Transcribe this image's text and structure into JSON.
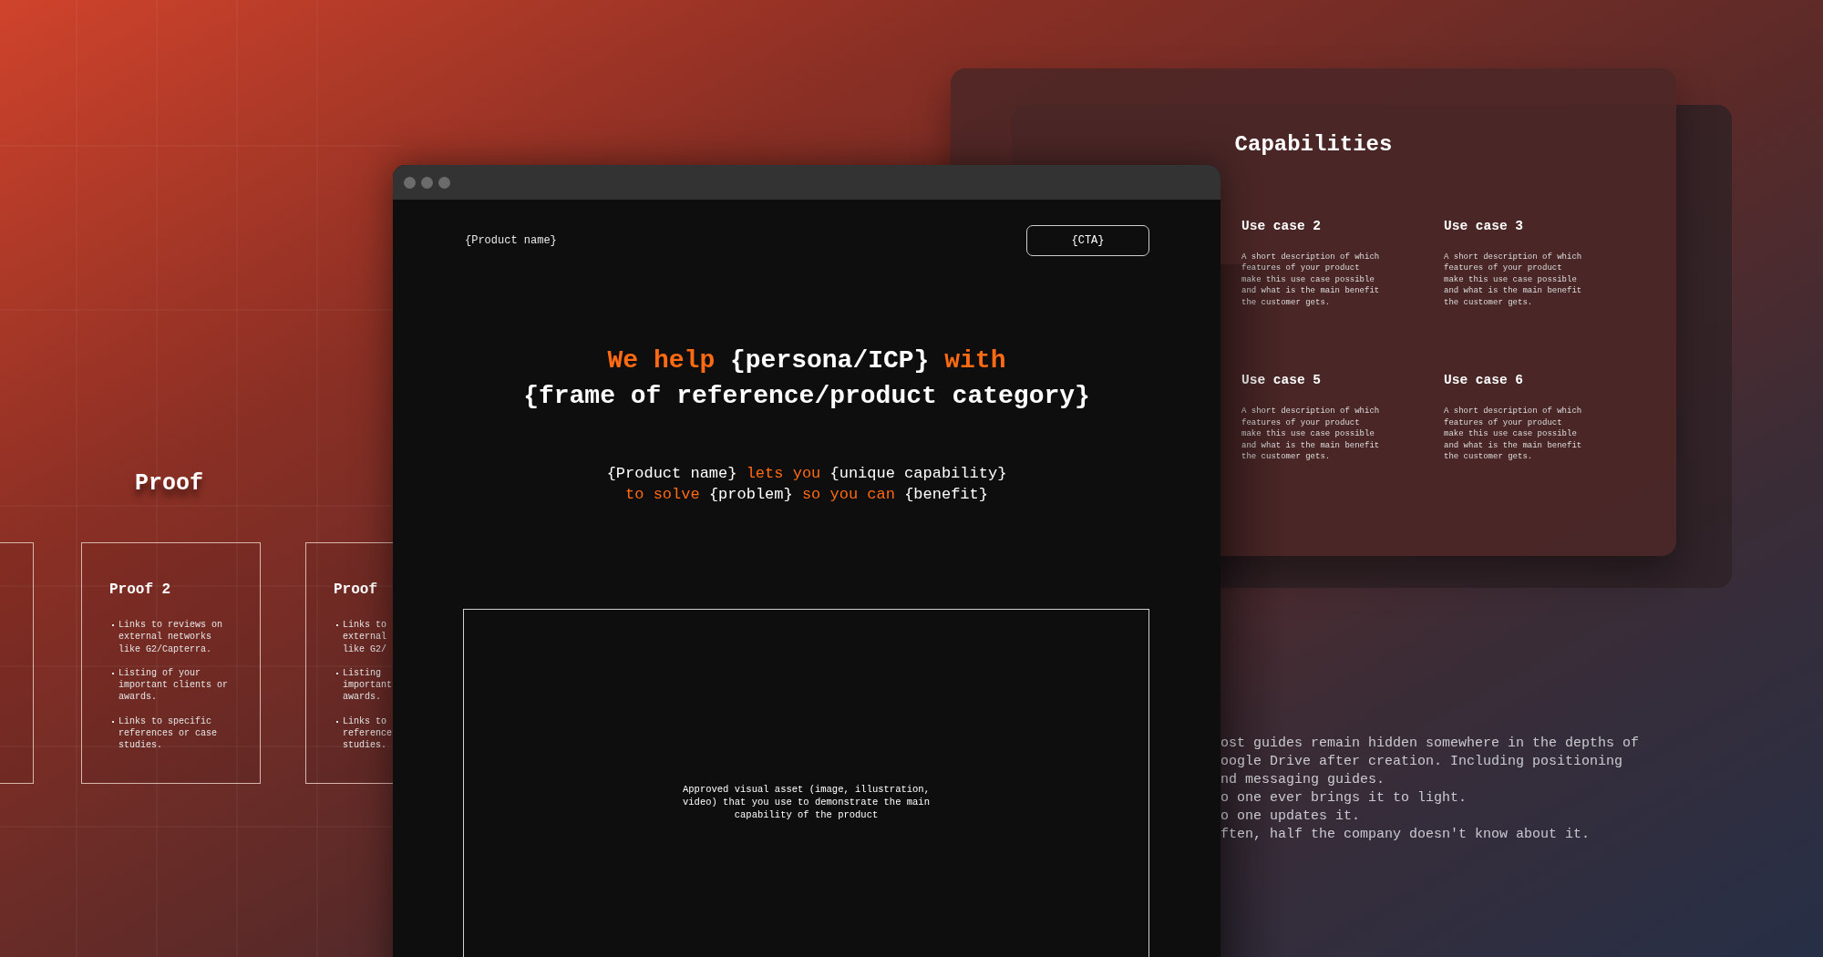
{
  "proof_section": {
    "title": "Proof",
    "cards": [
      {
        "kind": "blank"
      },
      {
        "kind": "text",
        "title": "Proof 2",
        "bullets": [
          [
            "Links to reviews on",
            "external networks",
            "like G2/Capterra."
          ],
          [
            "Listing of your",
            "important clients or",
            "awards."
          ],
          [
            "Links to specific",
            "references or case",
            "studies."
          ]
        ]
      },
      {
        "kind": "text",
        "title": "Proof",
        "bullets": [
          [
            "Links to",
            "external",
            "like G2/"
          ],
          [
            "Listing",
            "important",
            "awards."
          ],
          [
            "Links to",
            "reference",
            "studies."
          ]
        ]
      }
    ]
  },
  "capabilities": {
    "title": "Capabilities",
    "use_cases": [
      {
        "title": "Use case 2",
        "description": "A short description of which features of your product make this use case possible and what is the main benefit the customer gets."
      },
      {
        "title": "Use case 3",
        "description": "A short description of which features of your product make this use case possible and what is the main benefit the customer gets."
      },
      {
        "title": "Use case 5",
        "description": "A short description of which features of your product make this use case possible and what is the main benefit the customer gets."
      },
      {
        "title": "Use case 6",
        "description": "A short description of which features of your product make this use case possible and what is the main benefit the customer gets."
      }
    ]
  },
  "browser": {
    "product_name": "{Product name}",
    "cta": "{CTA}",
    "headline": [
      [
        {
          "text": "We help ",
          "accent": true
        },
        {
          "text": "{persona/ICP}",
          "accent": false
        },
        {
          "text": " with",
          "accent": true
        }
      ],
      [
        {
          "text": "{frame of reference/product category}",
          "accent": false
        }
      ]
    ],
    "subline": [
      [
        {
          "text": "{Product name}",
          "accent": false
        },
        {
          "text": " lets you ",
          "accent": true
        },
        {
          "text": "{unique capability}",
          "accent": false
        }
      ],
      [
        {
          "text": "to solve ",
          "accent": true
        },
        {
          "text": "{problem}",
          "accent": false
        },
        {
          "text": " so you can ",
          "accent": true
        },
        {
          "text": "{benefit}",
          "accent": false
        }
      ]
    ],
    "asset_text": "Approved visual asset (image, illustration, video) that you use to demonstrate the main capability of the product"
  },
  "note_lines": [
    "ost guides remain hidden somewhere in the depths of",
    "oogle Drive after creation. Including positioning",
    "nd messaging guides.",
    "o one ever brings it to light.",
    "o one updates it.",
    "ften, half the company doesn't know about it."
  ]
}
